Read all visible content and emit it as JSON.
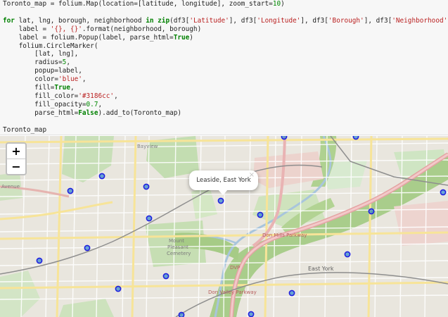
{
  "notebook": {
    "code_lines": [
      [
        [
          "Toronto_map = folium.Map(location=[latitude, longitude], zoom_start=",
          ""
        ],
        [
          "10",
          "num"
        ],
        [
          ")",
          ""
        ]
      ],
      [],
      [
        [
          "for",
          "kw"
        ],
        [
          " lat, lng, borough, neighborhood ",
          ""
        ],
        [
          "in",
          "kw"
        ],
        [
          " ",
          ""
        ],
        [
          "zip",
          "kw"
        ],
        [
          "(df3[",
          ""
        ],
        [
          "'Latitude'",
          "str"
        ],
        [
          "], df3[",
          ""
        ],
        [
          "'Longitude'",
          "str"
        ],
        [
          "], df3[",
          ""
        ],
        [
          "'Borough'",
          "str"
        ],
        [
          "], df3[",
          ""
        ],
        [
          "'Neighborhood'",
          "str"
        ],
        [
          "]):",
          ""
        ]
      ],
      [
        [
          "    label = ",
          ""
        ],
        [
          "'{}, {}'",
          "str"
        ],
        [
          ".format(neighborhood, borough)",
          ""
        ]
      ],
      [
        [
          "    label = folium.Popup(label, parse_html=",
          ""
        ],
        [
          "True",
          "kw"
        ],
        [
          ")",
          ""
        ]
      ],
      [
        [
          "    folium.CircleMarker(",
          ""
        ]
      ],
      [
        [
          "        [lat, lng],",
          ""
        ]
      ],
      [
        [
          "        radius=",
          ""
        ],
        [
          "5",
          "num"
        ],
        [
          ",",
          ""
        ]
      ],
      [
        [
          "        popup=label,",
          ""
        ]
      ],
      [
        [
          "        color=",
          ""
        ],
        [
          "'blue'",
          "str"
        ],
        [
          ",",
          ""
        ]
      ],
      [
        [
          "        fill=",
          ""
        ],
        [
          "True",
          "kw"
        ],
        [
          ",",
          ""
        ]
      ],
      [
        [
          "        fill_color=",
          ""
        ],
        [
          "'#3186cc'",
          "str"
        ],
        [
          ",",
          ""
        ]
      ],
      [
        [
          "        fill_opacity=",
          ""
        ],
        [
          "0.7",
          "num"
        ],
        [
          ",",
          ""
        ]
      ],
      [
        [
          "        parse_html=",
          ""
        ],
        [
          "False",
          "kw"
        ],
        [
          ").add_to(Toronto_map)",
          ""
        ]
      ],
      [],
      [
        [
          "Toronto_map",
          ""
        ]
      ]
    ]
  },
  "map": {
    "zoom_in_label": "+",
    "zoom_out_label": "−",
    "popup_text": "Leaside, East York",
    "popup_close": "×",
    "marker_stroke": "#1f1fe0",
    "marker_fill": "#3186cc",
    "labels": {
      "avenue": "Avenue",
      "mount": "Mount",
      "pleasant": "Pleasant",
      "cemetery": "Cemetery",
      "east_york": "East York",
      "dvp": "DVP",
      "don_mills_1": "Don Mills Parkway",
      "don_mills_2": "Don Valley Parkway",
      "bayview": "Bayview"
    }
  }
}
